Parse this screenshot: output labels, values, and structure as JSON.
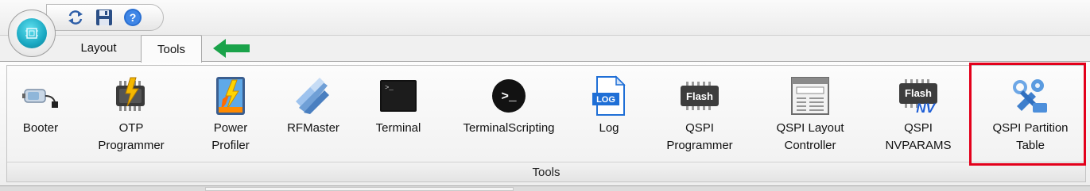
{
  "quick_access": {
    "items": [
      {
        "icon": "refresh-icon"
      },
      {
        "icon": "save-icon"
      },
      {
        "icon": "help-icon"
      }
    ]
  },
  "tabs": [
    {
      "label": "Layout",
      "active": false
    },
    {
      "label": "Tools",
      "active": true
    }
  ],
  "ribbon": {
    "group_label": "Tools",
    "tools": [
      {
        "label": "Booter",
        "icon": "booter-icon"
      },
      {
        "label": "OTP\nProgrammer",
        "icon": "otp-chip-icon"
      },
      {
        "label": "Power\nProfiler",
        "icon": "power-profiler-icon"
      },
      {
        "label": "RFMaster",
        "icon": "rfmaster-icon"
      },
      {
        "label": "Terminal",
        "icon": "terminal-icon"
      },
      {
        "label": "TerminalScripting",
        "icon": "terminal-scripting-icon"
      },
      {
        "label": "Log",
        "icon": "log-icon"
      },
      {
        "label": "QSPI\nProgrammer",
        "icon": "flash-chip-icon",
        "icon_text": "Flash"
      },
      {
        "label": "QSPI Layout\nController",
        "icon": "layout-controller-icon"
      },
      {
        "label": "QSPI\nNVPARAMS",
        "icon": "flash-nv-icon",
        "icon_text": "Flash",
        "icon_overlay": "NV"
      },
      {
        "label": "QSPI Partition\nTable",
        "icon": "partition-tools-icon"
      }
    ]
  },
  "log_icon_text": "LOG",
  "colors": {
    "highlight": "#e3001b",
    "arrow": "#1aa34a",
    "orb": "#1aa8c2"
  }
}
